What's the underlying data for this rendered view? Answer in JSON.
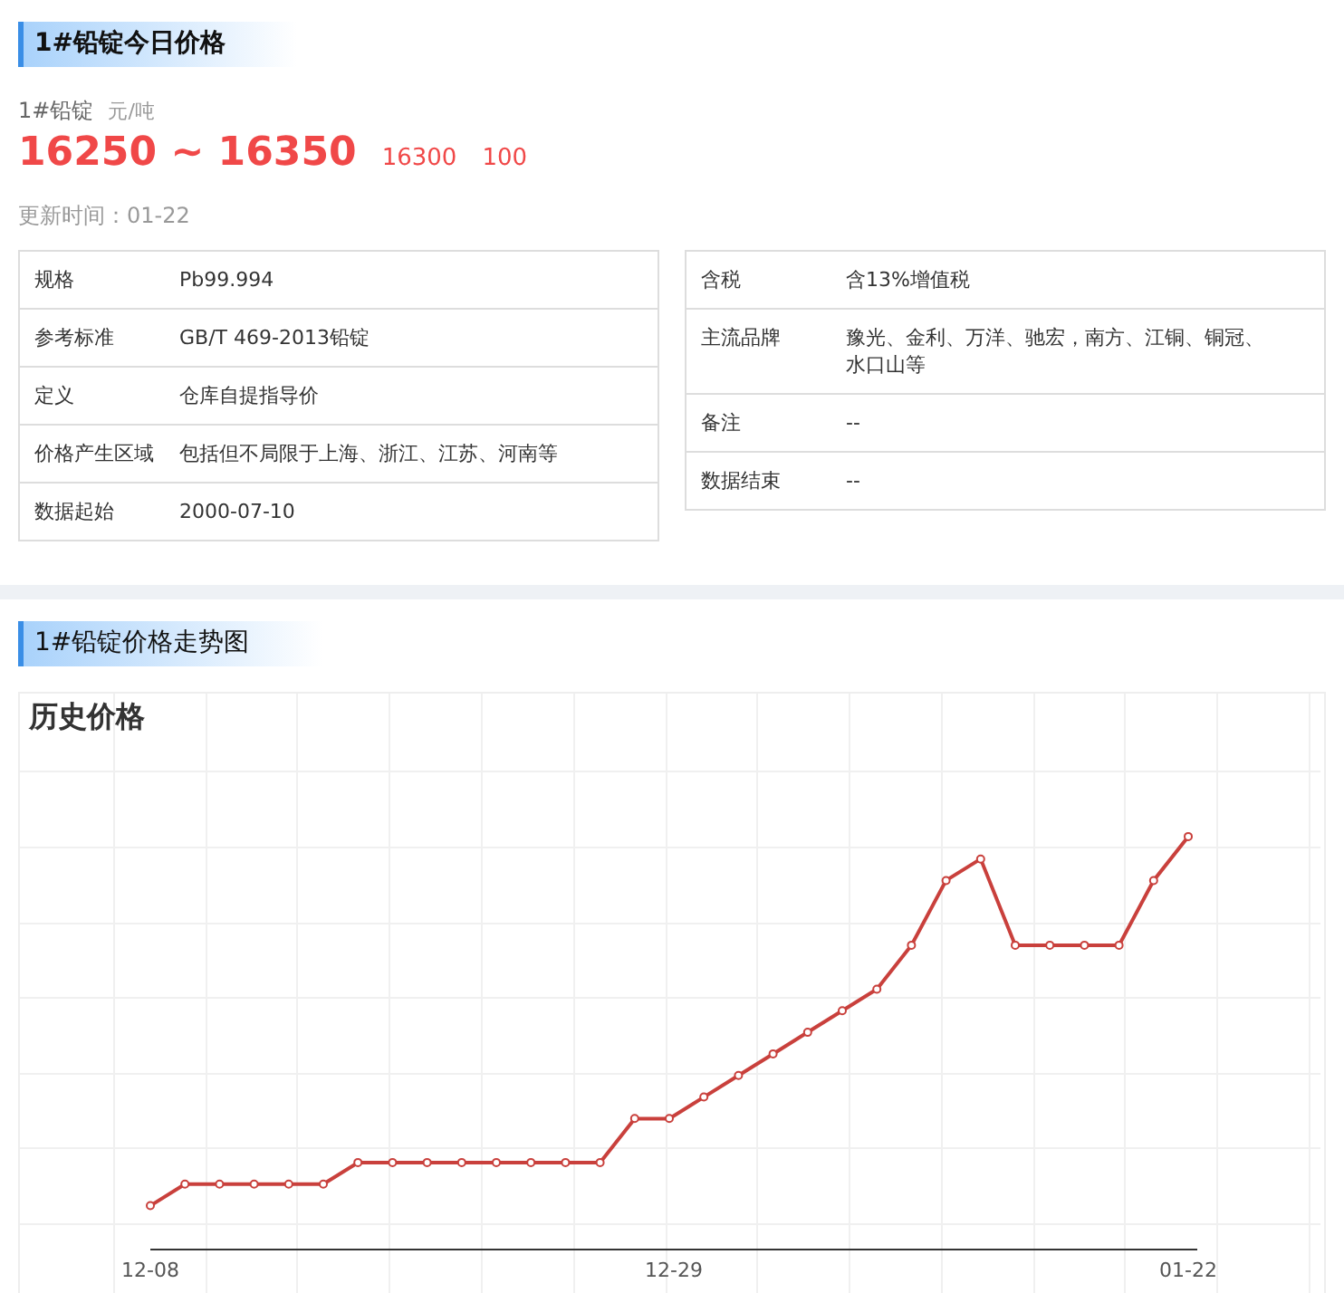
{
  "today": {
    "title": "1#铅锭今日价格",
    "product": "1#铅锭",
    "unit": "元/吨",
    "price_range": "16250 ~ 16350",
    "average": "16300",
    "change": "100",
    "updated": "更新时间：01-22",
    "left_table": [
      {
        "label": "规格",
        "value": "Pb99.994"
      },
      {
        "label": "参考标准",
        "value": "GB/T 469-2013铅锭"
      },
      {
        "label": "定义",
        "value": "仓库自提指导价"
      },
      {
        "label": "价格产生区域",
        "value": "包括但不局限于上海、浙江、江苏、河南等"
      },
      {
        "label": "数据起始",
        "value": "2000-07-10"
      }
    ],
    "right_table": [
      {
        "label": "含税",
        "value": "含13%增值税"
      },
      {
        "label": "主流品牌",
        "value": "豫光、金利、万洋、驰宏，南方、江铜、铜冠、水口山等"
      },
      {
        "label": "备注",
        "value": "--"
      },
      {
        "label": "数据结束",
        "value": "--"
      }
    ]
  },
  "trend": {
    "title": "1#铅锭价格走势图",
    "chart_title": "历史价格",
    "x_labels": [
      "12-08",
      "12-29",
      "01-22"
    ]
  }
}
